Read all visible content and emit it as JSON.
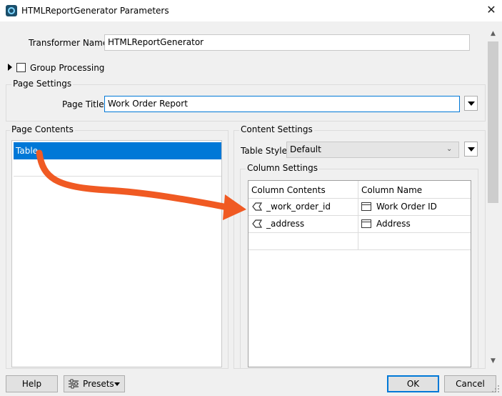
{
  "window": {
    "title": "HTMLReportGenerator Parameters",
    "close_glyph": "✕"
  },
  "transformer": {
    "label": "Transformer Name:",
    "value": "HTMLReportGenerator"
  },
  "group_processing": {
    "label": "Group Processing",
    "checked": false,
    "expanded": false
  },
  "page_settings": {
    "group_label": "Page Settings",
    "page_title_label": "Page Title:",
    "page_title_value": "Work Order Report"
  },
  "page_contents": {
    "group_label": "Page Contents",
    "items": [
      {
        "label": "Table",
        "selected": true
      }
    ]
  },
  "content_settings": {
    "group_label": "Content Settings",
    "table_style_label": "Table Style:",
    "table_style_value": "Default",
    "column_settings": {
      "group_label": "Column Settings",
      "headers": [
        "Column Contents",
        "Column Name"
      ],
      "rows": [
        {
          "contents": "_work_order_id",
          "name": "Work Order ID"
        },
        {
          "contents": "_address",
          "name": "Address"
        }
      ]
    }
  },
  "buttons": {
    "help": "Help",
    "presets": "Presets",
    "ok": "OK",
    "cancel": "Cancel"
  },
  "colors": {
    "selection": "#0078d7",
    "annotation_arrow": "#f05a23"
  },
  "icons": [
    "app-icon",
    "close-icon",
    "expand-triangle-icon",
    "attribute-icon",
    "text-value-icon",
    "presets-sliders-icon",
    "dropdown-arrow-icon"
  ]
}
